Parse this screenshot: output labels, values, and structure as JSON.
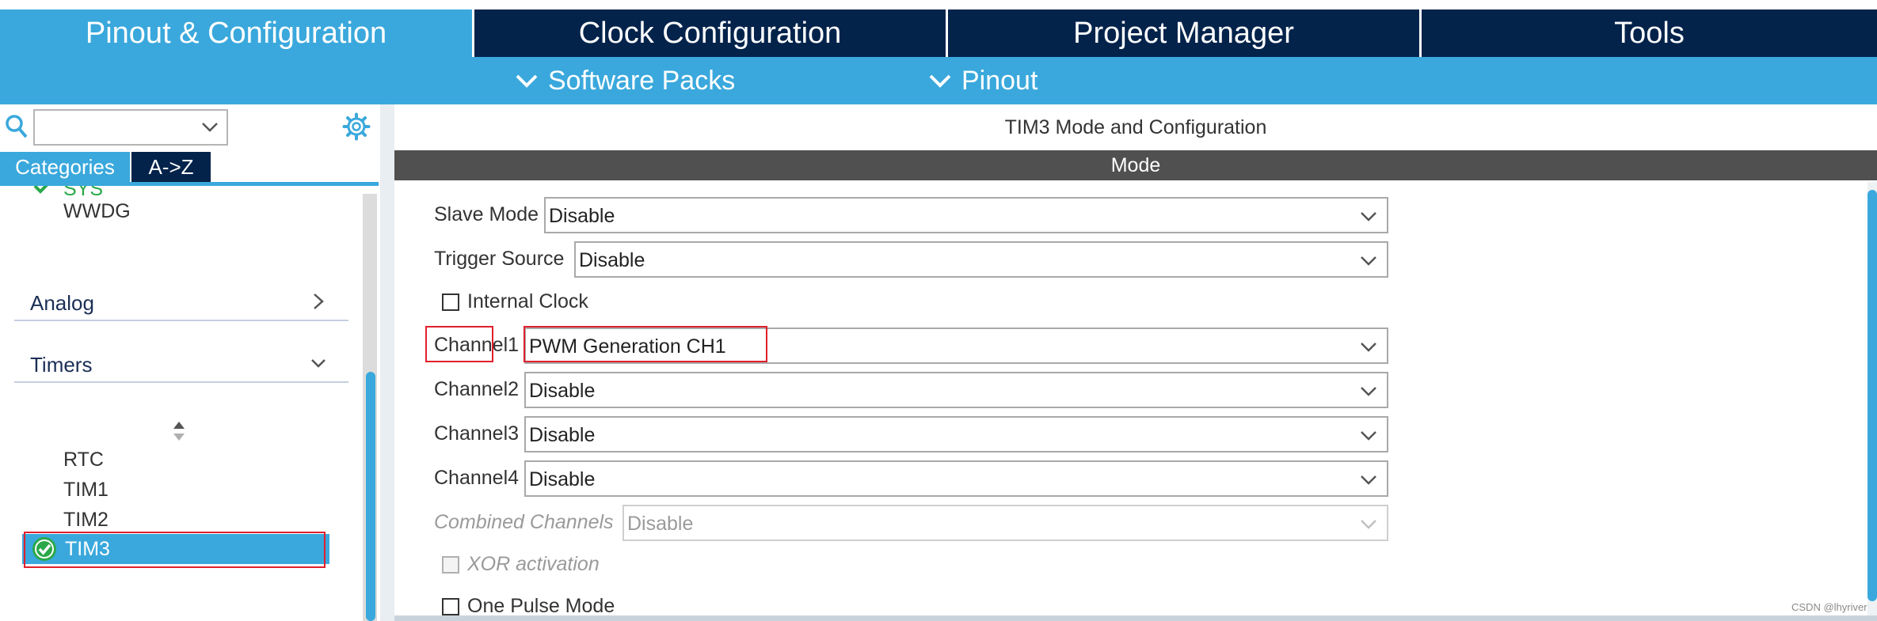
{
  "top_tabs": [
    "Pinout & Configuration",
    "Clock Configuration",
    "Project Manager",
    "Tools"
  ],
  "sub_menu": {
    "software_packs": "Software Packs",
    "pinout": "Pinout"
  },
  "left_panel": {
    "search_value": "",
    "category_tabs": [
      "Categories",
      "A->Z"
    ],
    "items_above": [
      "SYS",
      "WWDG"
    ],
    "groups": {
      "analog": "Analog",
      "timers": "Timers"
    },
    "timers": [
      "RTC",
      "TIM1",
      "TIM2",
      "TIM3"
    ]
  },
  "right_panel": {
    "title": "TIM3 Mode and Configuration",
    "section": "Mode",
    "fields": {
      "slave_mode": {
        "label": "Slave Mode",
        "value": "Disable"
      },
      "trigger_source": {
        "label": "Trigger Source",
        "value": "Disable"
      },
      "internal_clock": {
        "label": "Internal Clock"
      },
      "channel1": {
        "label": "Channel1",
        "value": "PWM Generation CH1"
      },
      "channel2": {
        "label": "Channel2",
        "value": "Disable"
      },
      "channel3": {
        "label": "Channel3",
        "value": "Disable"
      },
      "channel4": {
        "label": "Channel4",
        "value": "Disable"
      },
      "combined_channels": {
        "label": "Combined Channels",
        "value": "Disable"
      },
      "xor_activation": {
        "label": "XOR activation"
      },
      "one_pulse_mode": {
        "label": "One Pulse Mode"
      }
    }
  },
  "watermark": "CSDN @lhyriver",
  "colors": {
    "accent": "#3aa8dc",
    "dark_navy": "#03234b",
    "mode_bar": "#505050",
    "success_green": "#2aa84a",
    "highlight_red": "#e0202c"
  }
}
